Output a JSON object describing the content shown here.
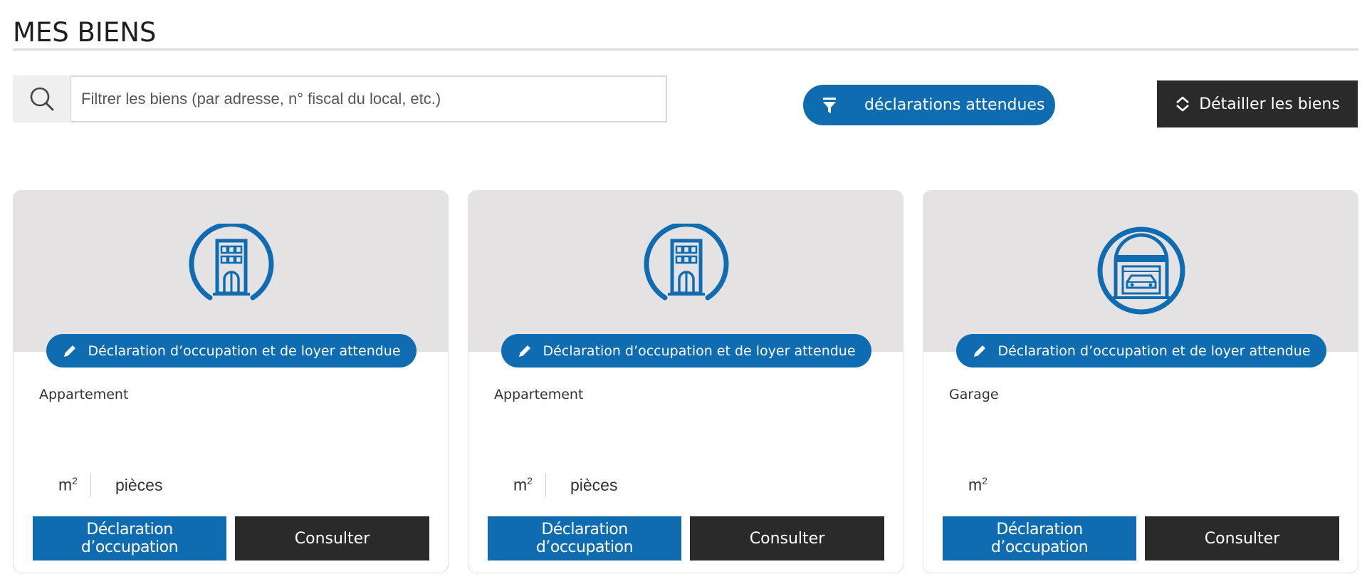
{
  "header": {
    "title": "MES BIENS"
  },
  "search": {
    "placeholder": "Filtrer les biens (par adresse, n° fiscal du local, etc.)",
    "value": ""
  },
  "filter": {
    "label": "déclarations attendues"
  },
  "detail": {
    "label": "Détailler les biens"
  },
  "colors": {
    "accent": "#0f6cb0",
    "dark": "#2a2a2a",
    "card_top": "#e4e2e3"
  },
  "cards": [
    {
      "icon": "apartment-building-icon",
      "badge": "Déclaration d’occupation et de loyer attendue",
      "type": "Appartement",
      "area_unit": "m",
      "area_exp": "2",
      "rooms_label": "pièces",
      "primary_action": "Déclaration d’occupation",
      "secondary_action": "Consulter"
    },
    {
      "icon": "apartment-building-icon",
      "badge": "Déclaration d’occupation et de loyer attendue",
      "type": "Appartement",
      "area_unit": "m",
      "area_exp": "2",
      "rooms_label": "pièces",
      "primary_action": "Déclaration d’occupation",
      "secondary_action": "Consulter"
    },
    {
      "icon": "garage-car-icon",
      "badge": "Déclaration d’occupation et de loyer attendue",
      "type": "Garage",
      "area_unit": "m",
      "area_exp": "2",
      "primary_action": "Déclaration d’occupation",
      "secondary_action": "Consulter"
    }
  ]
}
